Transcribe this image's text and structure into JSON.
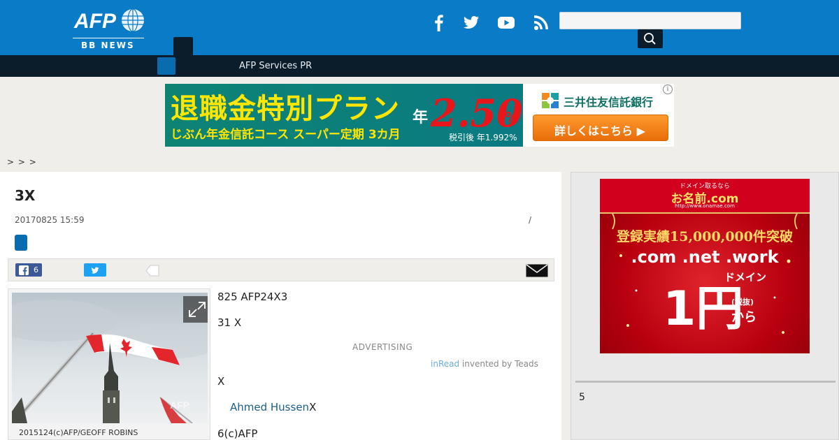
{
  "header": {
    "logo_text": "BB NEWS",
    "logo_mark": "AFP",
    "social_icons": [
      "facebook-icon",
      "twitter-icon",
      "youtube-icon",
      "rss-icon"
    ],
    "search": {
      "placeholder": "",
      "button_icon": "search-icon"
    },
    "colors": {
      "header_bg": "#0a7cc7",
      "nav_bg": "#0b1c2b"
    }
  },
  "nav": {
    "link": "AFP Services PR"
  },
  "banner_ad": {
    "headline": "退職金特別プラン",
    "subline": "じぶん年金信託コース スーパー定期 3カ月",
    "rate_prefix": "年",
    "rate": "2.50",
    "rate_unit": "%",
    "rate_after_tax": "税引後 年1.992%",
    "bank": "三井住友信託銀行",
    "cta": "詳しくはこちら ▶"
  },
  "breadcrumb": {
    "text": "> > >"
  },
  "article": {
    "title": "3X",
    "date": "20170825 15:59",
    "slash": "/",
    "fb_count": "6",
    "photo_caption": "2015124(c)AFP/GEOFF ROBINS",
    "p1": "825 AFP24X3",
    "p2": "31 X",
    "advertising": "ADVERTISING",
    "inread_link": "inRead",
    "inread_suffix": " invented by Teads",
    "p3": "X",
    "author_link": "Ahmed Hussen",
    "author_suffix": "X",
    "p5": "6(c)AFP"
  },
  "sidebar": {
    "ad": {
      "top_small": "ドメイン取るなら",
      "brand": "お名前.com",
      "url": "http://www.onamae.com",
      "record": "登録実績15,000,000件突破",
      "domains": ".com .net .work",
      "domain_word": "ドメイン",
      "price": "1円",
      "tax": "(税抜)",
      "from": "から"
    },
    "number": "5"
  }
}
